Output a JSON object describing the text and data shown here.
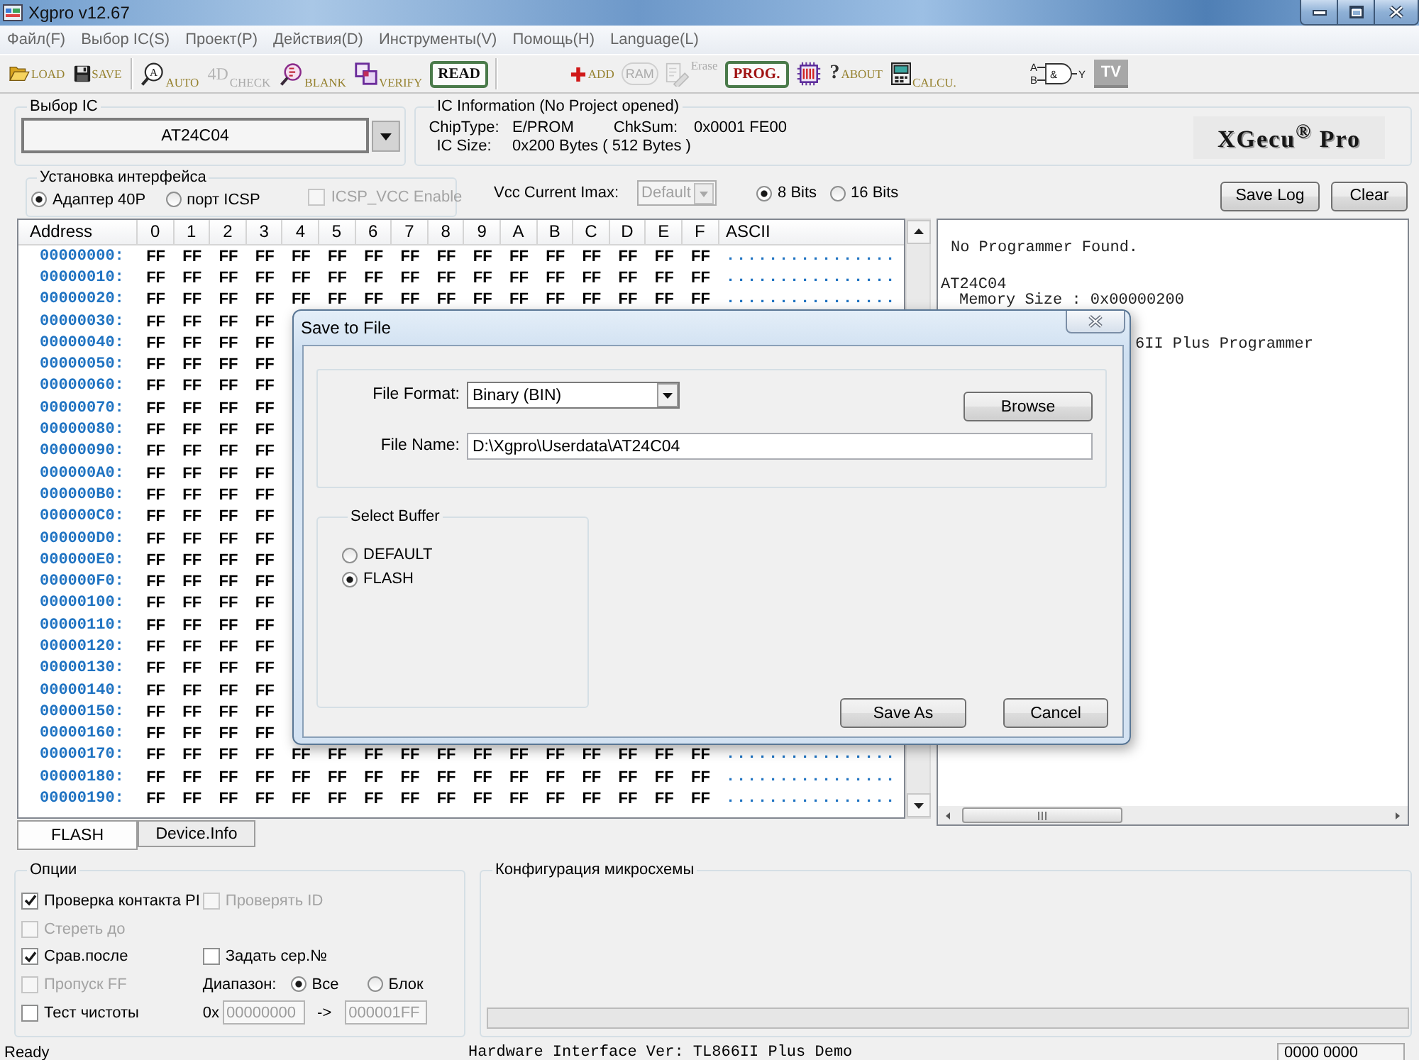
{
  "window": {
    "title": "Xgpro v12.67"
  },
  "menu": [
    "Файл(F)",
    "Выбор IC(S)",
    "Проект(P)",
    "Действия(D)",
    "Инструменты(V)",
    "Помощь(H)",
    "Language(L)"
  ],
  "toolbar": [
    {
      "kind": "icon",
      "label": "LOAD",
      "disabled": false
    },
    {
      "kind": "icon",
      "label": "SAVE",
      "disabled": false
    },
    {
      "kind": "sub",
      "label": "AUTO",
      "icon_text": "A",
      "disabled": false
    },
    {
      "kind": "sub",
      "label": "CHECK",
      "icon_text": "4D",
      "disabled": true
    },
    {
      "kind": "sub",
      "label": "BLANK",
      "disabled": false
    },
    {
      "kind": "sub",
      "label": "VERIFY",
      "disabled": false
    },
    {
      "kind": "boxed",
      "label": "READ",
      "disabled": false
    },
    {
      "kind": "icon",
      "label": "ADD",
      "disabled": false
    },
    {
      "kind": "stamp",
      "label": "RAM",
      "disabled": true
    },
    {
      "kind": "sup",
      "label": "Erase",
      "disabled": true
    },
    {
      "kind": "boxed",
      "label": "PROG.",
      "disabled": false
    },
    {
      "kind": "plain",
      "disabled": false
    },
    {
      "kind": "icon",
      "label": "ABOUT",
      "icon_text": "?",
      "disabled": false
    },
    {
      "kind": "sub",
      "label": "CALCU.",
      "disabled": false
    },
    {
      "kind": "gate",
      "inputs": [
        "A",
        "B"
      ],
      "symbol": "&",
      "output": "Y",
      "disabled": false
    },
    {
      "kind": "tile",
      "label": "TV",
      "disabled": false
    }
  ],
  "ic_select": {
    "title": "Выбор IC",
    "value": "AT24C04"
  },
  "ic_info": {
    "title": "IC Information (No Project opened)",
    "fields": [
      {
        "label": "ChipType:",
        "value": "E/PROM"
      },
      {
        "label": "ChkSum:",
        "value": "0x0001 FE00"
      },
      {
        "label": "IC Size:",
        "value": "0x200 Bytes ( 512 Bytes )"
      }
    ],
    "logo": "XGecu$^{®}$ Pro"
  },
  "interface": {
    "title": "Установка интерфейса",
    "ports": [
      {
        "label": "Адаптер 40P",
        "selected": true
      },
      {
        "label": "порт ICSP",
        "selected": false
      }
    ],
    "icsp_vcc": {
      "label": "ICSP_VCC Enable",
      "checked": false,
      "disabled": true
    }
  },
  "vcc_current": {
    "label": "Vcc Current Imax:",
    "value": "Default",
    "disabled": true
  },
  "bits": [
    {
      "label": "8 Bits",
      "selected": true
    },
    {
      "label": "16 Bits",
      "selected": false
    }
  ],
  "log_buttons": [
    "Save Log",
    "Clear"
  ],
  "hex": {
    "columns": [
      "Address",
      "0",
      "1",
      "2",
      "3",
      "4",
      "5",
      "6",
      "7",
      "8",
      "9",
      "A",
      "B",
      "C",
      "D",
      "E",
      "F",
      "ASCII"
    ],
    "rows": [
      {
        "address": "00000000:",
        "values": [
          "FF",
          "FF",
          "FF",
          "FF",
          "FF",
          "FF",
          "FF",
          "FF",
          "FF",
          "FF",
          "FF",
          "FF",
          "FF",
          "FF",
          "FF",
          "FF"
        ],
        "ascii": "................"
      },
      {
        "address": "00000010:",
        "values": [
          "FF",
          "FF",
          "FF",
          "FF",
          "FF",
          "FF",
          "FF",
          "FF",
          "FF",
          "FF",
          "FF",
          "FF",
          "FF",
          "FF",
          "FF",
          "FF"
        ],
        "ascii": "................"
      },
      {
        "address": "00000020:",
        "values": [
          "FF",
          "FF",
          "FF",
          "FF",
          "FF",
          "FF",
          "FF",
          "FF",
          "FF",
          "FF",
          "FF",
          "FF",
          "FF",
          "FF",
          "FF",
          "FF"
        ],
        "ascii": "................"
      },
      {
        "address": "00000030:",
        "values": [
          "FF",
          "FF",
          "FF",
          "FF"
        ]
      },
      {
        "address": "00000040:",
        "values": [
          "FF",
          "FF",
          "FF",
          "FF"
        ]
      },
      {
        "address": "00000050:",
        "values": [
          "FF",
          "FF",
          "FF",
          "FF"
        ]
      },
      {
        "address": "00000060:",
        "values": [
          "FF",
          "FF",
          "FF",
          "FF"
        ]
      },
      {
        "address": "00000070:",
        "values": [
          "FF",
          "FF",
          "FF",
          "FF"
        ]
      },
      {
        "address": "00000080:",
        "values": [
          "FF",
          "FF",
          "FF",
          "FF"
        ]
      },
      {
        "address": "00000090:",
        "values": [
          "FF",
          "FF",
          "FF",
          "FF"
        ]
      },
      {
        "address": "000000A0:",
        "values": [
          "FF",
          "FF",
          "FF",
          "FF"
        ]
      },
      {
        "address": "000000B0:",
        "values": [
          "FF",
          "FF",
          "FF",
          "FF"
        ]
      },
      {
        "address": "000000C0:",
        "values": [
          "FF",
          "FF",
          "FF",
          "FF"
        ]
      },
      {
        "address": "000000D0:",
        "values": [
          "FF",
          "FF",
          "FF",
          "FF"
        ]
      },
      {
        "address": "000000E0:",
        "values": [
          "FF",
          "FF",
          "FF",
          "FF"
        ]
      },
      {
        "address": "000000F0:",
        "values": [
          "FF",
          "FF",
          "FF",
          "FF"
        ]
      },
      {
        "address": "00000100:",
        "values": [
          "FF",
          "FF",
          "FF",
          "FF"
        ]
      },
      {
        "address": "00000110:",
        "values": [
          "FF",
          "FF",
          "FF",
          "FF"
        ]
      },
      {
        "address": "00000120:",
        "values": [
          "FF",
          "FF",
          "FF",
          "FF"
        ]
      },
      {
        "address": "00000130:",
        "values": [
          "FF",
          "FF",
          "FF",
          "FF"
        ]
      },
      {
        "address": "00000140:",
        "values": [
          "FF",
          "FF",
          "FF",
          "FF"
        ]
      },
      {
        "address": "00000150:",
        "values": [
          "FF",
          "FF",
          "FF",
          "FF"
        ]
      },
      {
        "address": "00000160:",
        "values": [
          "FF",
          "FF",
          "FF",
          "FF"
        ]
      },
      {
        "address": "00000170:",
        "values": [
          "FF",
          "FF",
          "FF",
          "FF",
          "FF",
          "FF",
          "FF",
          "FF",
          "FF",
          "FF",
          "FF",
          "FF",
          "FF",
          "FF",
          "FF",
          "FF"
        ],
        "ascii": "................"
      },
      {
        "address": "00000180:",
        "values": [
          "FF",
          "FF",
          "FF",
          "FF",
          "FF",
          "FF",
          "FF",
          "FF",
          "FF",
          "FF",
          "FF",
          "FF",
          "FF",
          "FF",
          "FF",
          "FF"
        ],
        "ascii": "................"
      },
      {
        "address": "00000190:",
        "values": [
          "FF",
          "FF",
          "FF",
          "FF",
          "FF",
          "FF",
          "FF",
          "FF",
          "FF",
          "FF",
          "FF",
          "FF",
          "FF",
          "FF",
          "FF",
          "FF"
        ],
        "ascii": "................"
      }
    ]
  },
  "tabs": [
    {
      "label": "FLASH",
      "selected": true
    },
    {
      "label": "Device.Info",
      "selected": false
    }
  ],
  "log": [
    {
      "kind": "note",
      "text": "No Programmer Found."
    },
    {
      "kind": "chip",
      "text": "AT24C04"
    },
    {
      "kind": "detail",
      "text": "Memory Size : 0x00000200"
    },
    {
      "kind": "covered",
      "text": "6II Plus Programmer"
    }
  ],
  "options": {
    "title": "Опции",
    "rows": [
      {
        "items": [
          {
            "kind": "checkbox",
            "label": "Проверка контакта PI",
            "checked": true,
            "disabled": false
          },
          {
            "kind": "checkbox",
            "label": "Проверять ID",
            "checked": false,
            "disabled": true
          }
        ]
      },
      {
        "items": [
          {
            "kind": "checkbox",
            "label": "Стереть до",
            "checked": false,
            "disabled": true
          }
        ]
      },
      {
        "items": [
          {
            "kind": "checkbox",
            "label": "Срав.после",
            "checked": true,
            "disabled": false
          },
          {
            "kind": "checkbox",
            "label": "Задать сер.№",
            "checked": false,
            "disabled": false
          }
        ]
      },
      {
        "items": [
          {
            "kind": "checkbox",
            "label": "Пропуск FF",
            "checked": false,
            "disabled": true
          },
          {
            "kind": "range",
            "label": "Диапазон:",
            "choices": [
              {
                "label": "Все",
                "selected": true
              },
              {
                "label": "Блок",
                "selected": false
              }
            ]
          }
        ]
      },
      {
        "items": [
          {
            "kind": "checkbox",
            "label": "Тест чистоты",
            "checked": false,
            "disabled": false
          },
          {
            "kind": "addresses",
            "prefix": "0x",
            "from": "00000000",
            "arrow": "->",
            "to": "000001FF",
            "disabled": true
          }
        ]
      }
    ]
  },
  "config": {
    "title": "Конфигурация микросхемы",
    "progress": {
      "level": 0
    }
  },
  "status_bar": {
    "left": "Ready",
    "center": "Hardware Interface Ver: TL866II Plus Demo",
    "right": "0000 0000"
  },
  "dialog": {
    "title": "Save to File",
    "file_format": {
      "label": "File Format:",
      "value": "Binary (BIN)"
    },
    "browse": "Browse",
    "file_name": {
      "label": "File Name:",
      "value": "D:\\Xgpro\\Userdata\\AT24C04"
    },
    "buffer": {
      "title": "Select Buffer",
      "options": [
        {
          "label": "DEFAULT",
          "selected": false
        },
        {
          "label": "FLASH",
          "selected": true
        }
      ]
    },
    "buttons": [
      "Save As",
      "Cancel"
    ]
  }
}
